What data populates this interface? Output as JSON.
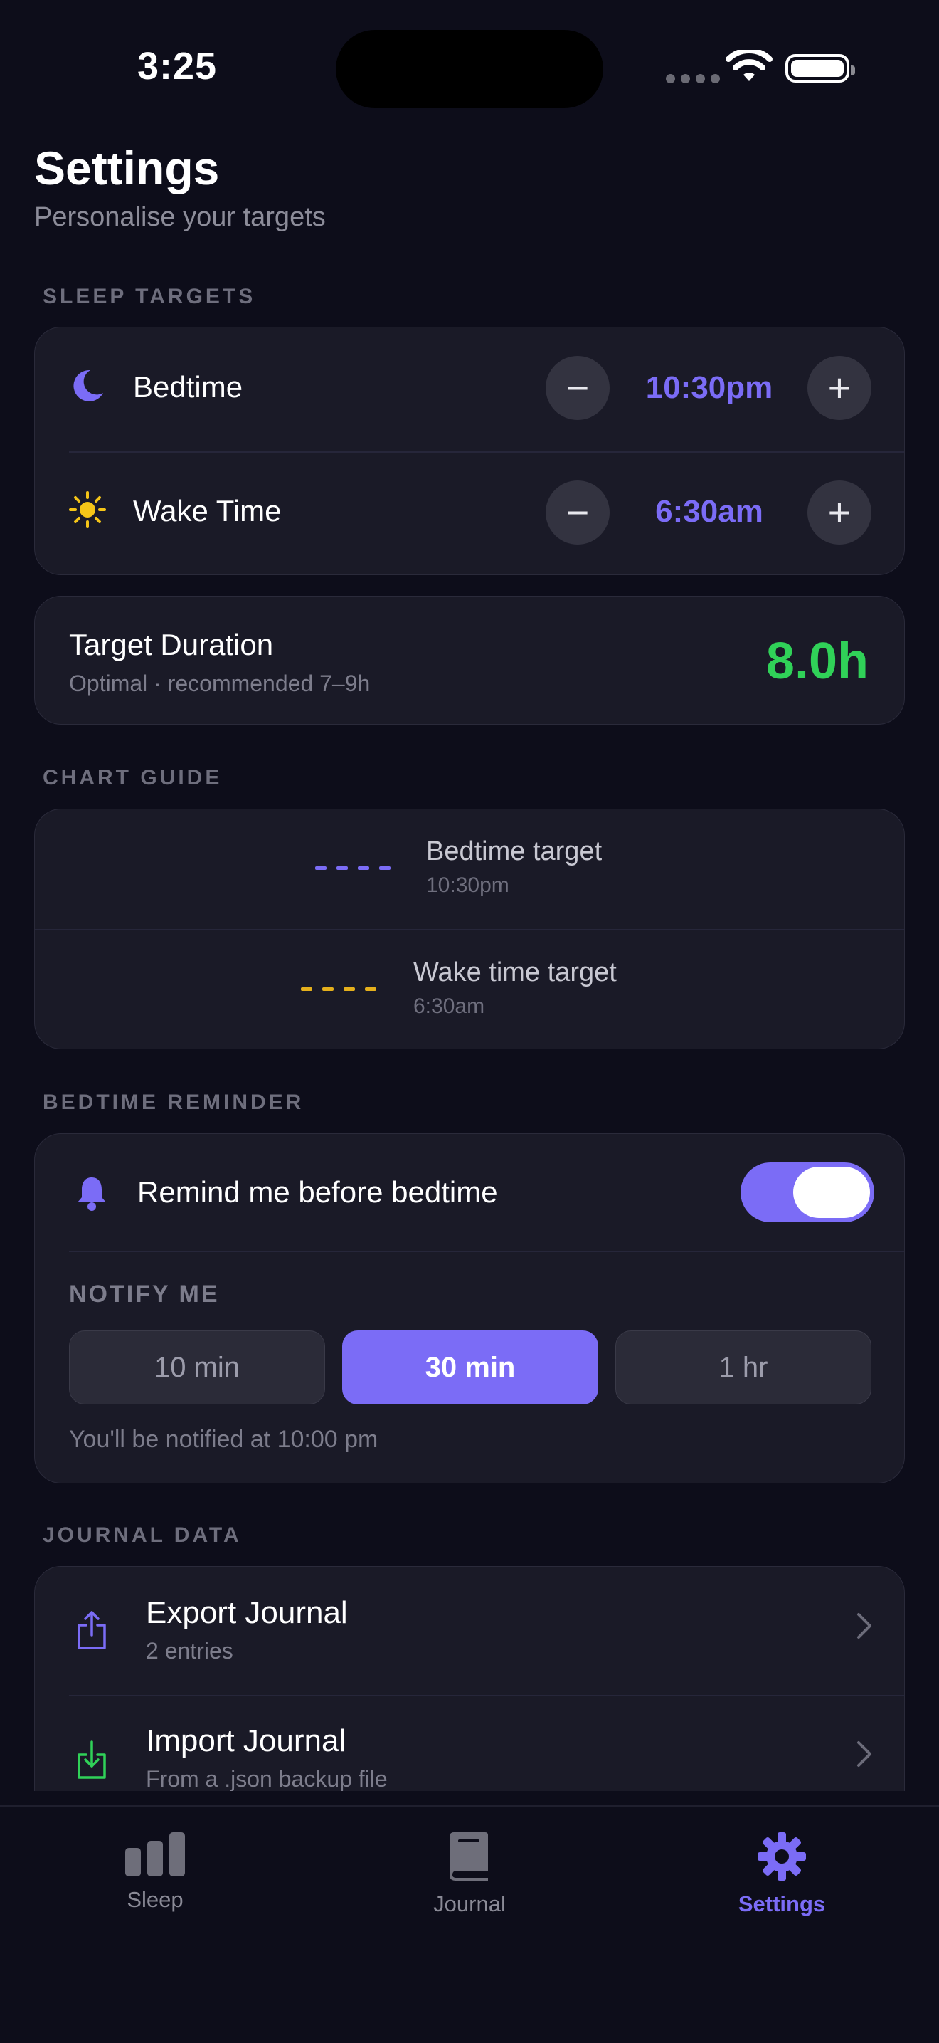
{
  "status_bar": {
    "time": "3:25"
  },
  "header": {
    "title": "Settings",
    "subtitle": "Personalise your targets"
  },
  "sections": {
    "sleep_targets": "SLEEP TARGETS",
    "chart_guide": "CHART GUIDE",
    "bedtime_reminder": "BEDTIME REMINDER",
    "journal_data": "JOURNAL DATA"
  },
  "sleep_targets": {
    "bedtime": {
      "label": "Bedtime",
      "value": "10:30pm",
      "icon": "moon-icon"
    },
    "wake": {
      "label": "Wake Time",
      "value": "6:30am",
      "icon": "sun-icon"
    }
  },
  "duration": {
    "title": "Target Duration",
    "subtitle": "Optimal · recommended 7–9h",
    "value": "8.0h",
    "color": "#30d158"
  },
  "chart_guide": {
    "bedtime": {
      "title": "Bedtime target",
      "time": "10:30pm",
      "color": "#7b6cf6"
    },
    "wake": {
      "title": "Wake time target",
      "time": "6:30am",
      "color": "#e5b01c"
    }
  },
  "reminder": {
    "label": "Remind me before bedtime",
    "enabled": true,
    "notify_label": "NOTIFY ME",
    "options": [
      "10 min",
      "30 min",
      "1 hr"
    ],
    "selected": "30 min",
    "note": "You'll be notified at 10:00 pm"
  },
  "journal": {
    "export": {
      "title": "Export Journal",
      "subtitle": "2 entries"
    },
    "import": {
      "title": "Import Journal",
      "subtitle": "From a .json backup file"
    }
  },
  "tabs": [
    {
      "label": "Sleep",
      "icon": "bar-chart-icon",
      "active": false
    },
    {
      "label": "Journal",
      "icon": "book-icon",
      "active": false
    },
    {
      "label": "Settings",
      "icon": "gear-icon",
      "active": true
    }
  ],
  "colors": {
    "accent": "#7b6cf6",
    "background": "#0d0d1a",
    "card": "#1a1a27",
    "success": "#30d158",
    "warning": "#e5b01c"
  }
}
